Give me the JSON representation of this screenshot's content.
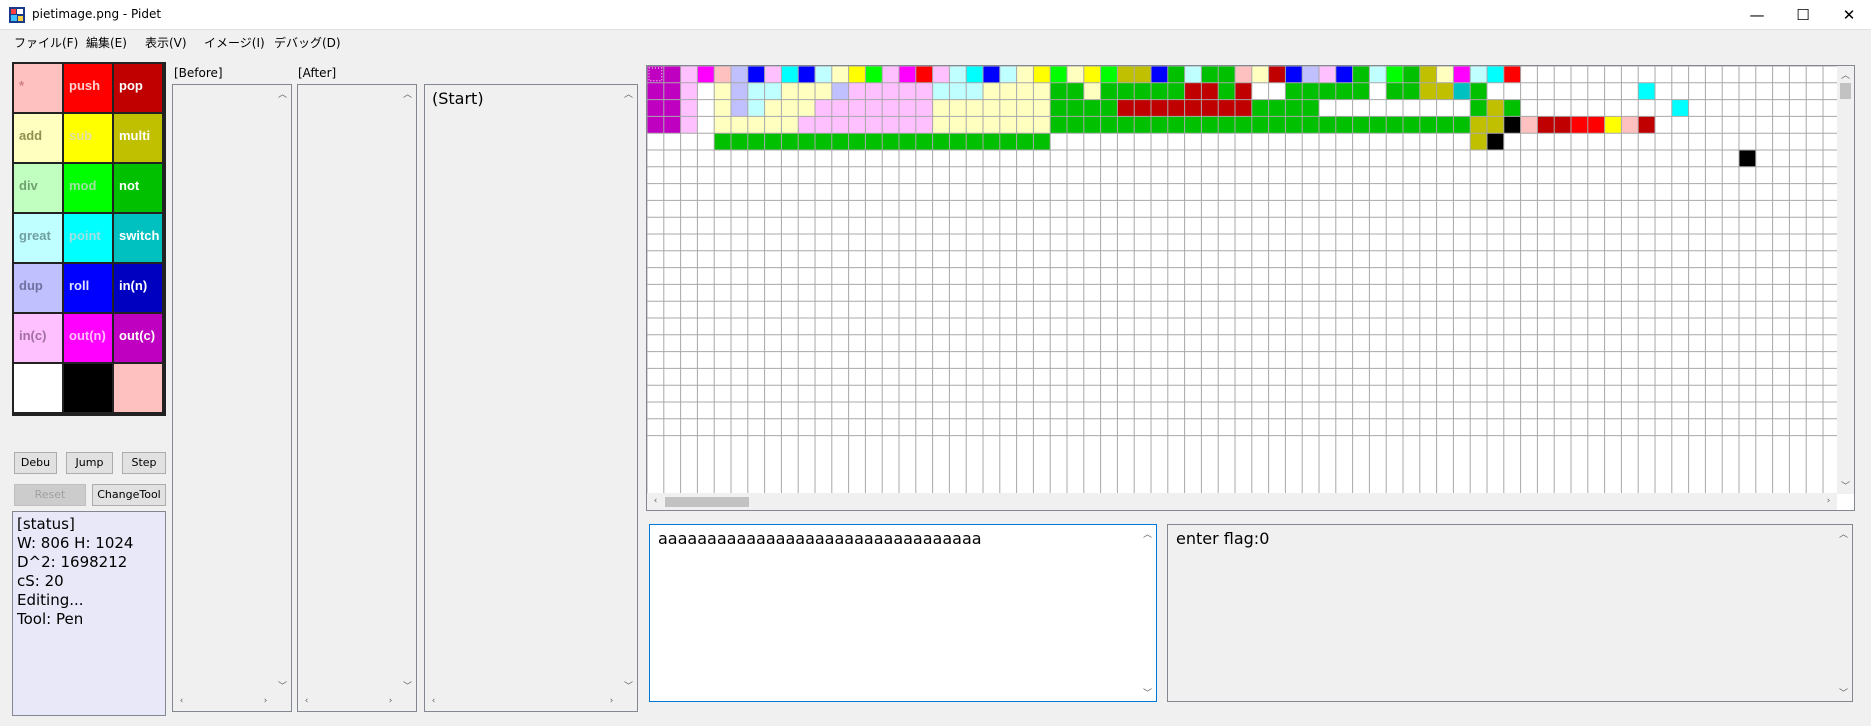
{
  "window": {
    "title": "pietimage.png - Pidet",
    "minimize": "—",
    "maximize": "☐",
    "close": "✕"
  },
  "menu": [
    "ファイル(F)",
    "編集(E)",
    "表示(V)",
    "イメージ(I)",
    "デバッグ(D)"
  ],
  "palette": [
    [
      {
        "label": "*",
        "bg": "#ffc0c0",
        "fg": "#d08080"
      },
      {
        "label": "push",
        "bg": "#ff0000",
        "fg": "#ffd0d0"
      },
      {
        "label": "pop",
        "bg": "#c00000",
        "fg": "#ffffff"
      }
    ],
    [
      {
        "label": "add",
        "bg": "#ffffc0",
        "fg": "#909050"
      },
      {
        "label": "sub",
        "bg": "#ffff00",
        "fg": "#e0e0a0"
      },
      {
        "label": "multi",
        "bg": "#c0c000",
        "fg": "#ffffff"
      }
    ],
    [
      {
        "label": "div",
        "bg": "#c0ffc0",
        "fg": "#70a070"
      },
      {
        "label": "mod",
        "bg": "#00ff00",
        "fg": "#a0e0a0"
      },
      {
        "label": "not",
        "bg": "#00c000",
        "fg": "#ffffff"
      }
    ],
    [
      {
        "label": "great",
        "bg": "#c0ffff",
        "fg": "#70a0a0"
      },
      {
        "label": "point",
        "bg": "#00ffff",
        "fg": "#a0e0e0"
      },
      {
        "label": "switch",
        "bg": "#00c0c0",
        "fg": "#ffffff"
      }
    ],
    [
      {
        "label": "dup",
        "bg": "#c0c0ff",
        "fg": "#7070a0"
      },
      {
        "label": "roll",
        "bg": "#0000ff",
        "fg": "#e0e0ff"
      },
      {
        "label": "in(n)",
        "bg": "#0000c0",
        "fg": "#ffffff"
      }
    ],
    [
      {
        "label": "in(c)",
        "bg": "#ffc0ff",
        "fg": "#a070a0"
      },
      {
        "label": "out(n)",
        "bg": "#ff00ff",
        "fg": "#ffc0ff"
      },
      {
        "label": "out(c)",
        "bg": "#c000c0",
        "fg": "#ffffff"
      }
    ],
    [
      {
        "label": "",
        "bg": "#ffffff",
        "fg": "#000"
      },
      {
        "label": "",
        "bg": "#000000",
        "fg": "#fff"
      },
      {
        "label": "",
        "bg": "#ffc0c0",
        "fg": "#000"
      }
    ]
  ],
  "buttons": {
    "debug": "Debu",
    "jump": "Jump",
    "step": "Step",
    "reset": "Reset",
    "change_tool": "ChangeTool"
  },
  "status": {
    "lines": [
      "[status]",
      "W: 806 H: 1024",
      "D^2: 1698212",
      "cS: 20",
      "",
      "Editing...",
      "Tool: Pen"
    ]
  },
  "panels": {
    "before_label": "[Before]",
    "after_label": "[After]",
    "trace_text": "(Start)"
  },
  "code_input": "aaaaaaaaaaaaaaaaaaaaaaaaaaaaaaaaa",
  "output": "enter flag:0",
  "colors": {
    "W": "#ffffff",
    "K": "#000000",
    "r": "#ffc0c0",
    "R": "#ff0000",
    "d": "#c00000",
    "y": "#ffffc0",
    "Y": "#ffff00",
    "o": "#c0c000",
    "g": "#c0ffc0",
    "G": "#00ff00",
    "e": "#00c000",
    "c": "#c0ffff",
    "C": "#00ffff",
    "t": "#00c0c0",
    "b": "#c0c0ff",
    "B": "#0000ff",
    "n": "#0000c0",
    "m": "#ffc0ff",
    "M": "#ff00ff",
    "P": "#c000c0"
  },
  "grid": {
    "cols": 72,
    "rows": 22,
    "pixel_rows": [
      "PPmMrbBmCBcyYGmMRmcCBcyYGyYGooBeceerydBbmBecGeoyMcCRW",
      "PPmWybccyyybmmmmmcccyyyyeeyeeeeeddedWWeeeeeWeeooteWWWWWWWWWCW",
      "PPmWybcyyymmmmmmmyyyyyyyeeeeddddddddeeeeWWWWWWWWWeoeWWWWWWWWWCW",
      "PPmWyyyyymmmmmmmmyyyyyyyeeeeeeeeeeeeeeeeeeeeeeeeeooKrddRRYrdW",
      "WWWWeeeeeeeeeeeeeeeeeeeeWWWWWWWWWWWWWWWWWWWWWWWWWoKW",
      "WWWWWWWWWWWWWWWWWWWWWWWWWWWWWWWWWWWWWWWWWWWWWWWWWWWWWWWWWWWWWWWWWK"
    ]
  }
}
